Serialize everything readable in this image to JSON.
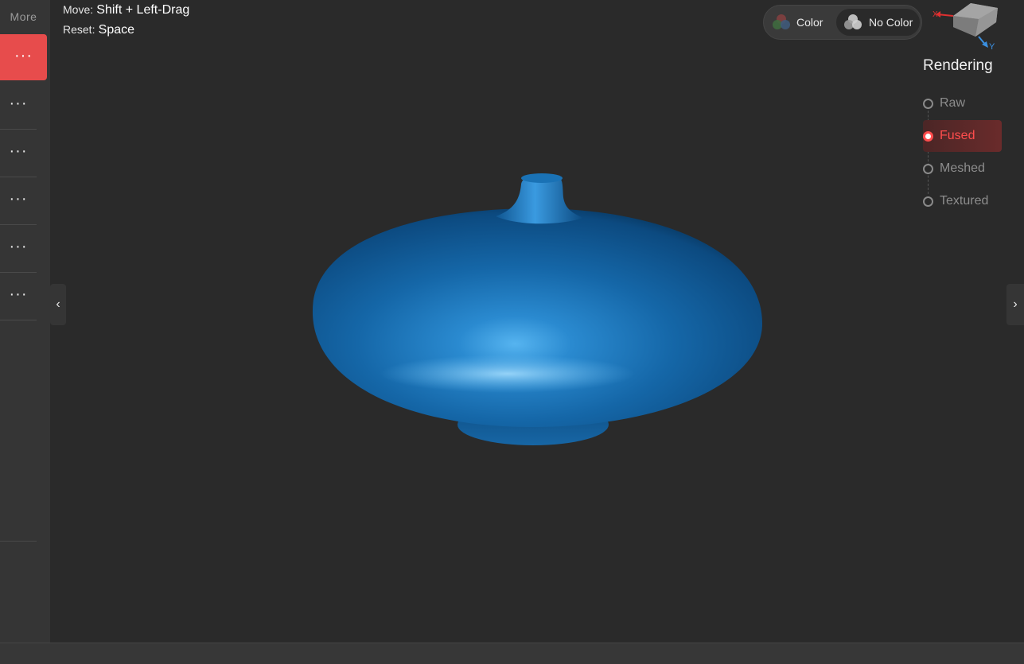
{
  "sidebar": {
    "more_label": "More",
    "items": [
      {
        "label": "···",
        "active": true
      },
      {
        "label": "···",
        "active": false
      },
      {
        "label": "···",
        "active": false
      },
      {
        "label": "···",
        "active": false
      },
      {
        "label": "···",
        "active": false
      },
      {
        "label": "···",
        "active": false
      }
    ]
  },
  "hints": {
    "move_key": "Move:",
    "move_value": "Shift + Left-Drag",
    "reset_key": "Reset:",
    "reset_value": "Space"
  },
  "color_toggle": {
    "color_label": "Color",
    "no_color_label": "No Color",
    "selected": "No Color"
  },
  "viewcube": {
    "axis_x": "X",
    "axis_y": "Y"
  },
  "rendering": {
    "title": "Rendering",
    "options": [
      "Raw",
      "Fused",
      "Meshed",
      "Textured"
    ],
    "selected": "Fused"
  },
  "handles": {
    "left": "‹",
    "right": "›"
  },
  "colors": {
    "accent": "#e74c4c",
    "model": "#1a6fb0",
    "background": "#2a2a2a",
    "sidebar": "#353535"
  }
}
